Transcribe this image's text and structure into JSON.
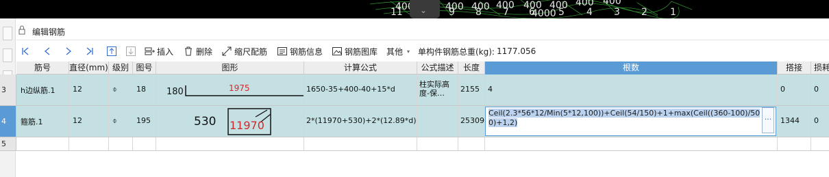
{
  "cad": {
    "dims": [
      "400",
      "400",
      "400",
      "400",
      "400",
      "400",
      "400",
      "400",
      "400"
    ],
    "dim_center": "4000",
    "nums": [
      "11",
      "9",
      "8",
      "7",
      "6",
      "5",
      "4",
      "3",
      "2",
      "1"
    ],
    "handle_glyph": "⌄"
  },
  "panel": {
    "title": "编辑钢筋"
  },
  "toolbar": {
    "insert": "插入",
    "delete": "删除",
    "scale": "缩尺配筋",
    "info": "钢筋信息",
    "library": "钢筋图库",
    "other": "其他",
    "total_label": "单构件钢筋总重(kg):",
    "total_value": "1177.056"
  },
  "columns": [
    "筋号",
    "直径(mm)",
    "级别",
    "图号",
    "图形",
    "计算公式",
    "公式描述",
    "长度",
    "根数",
    "搭接",
    "损耗"
  ],
  "rows": [
    {
      "num": "3",
      "name": "h边纵筋.1",
      "dia": "12",
      "grade": "⌽",
      "fig": "18",
      "shape_a": "180",
      "shape_b": "1975",
      "formula": "1650-35+400-40+15*d",
      "desc": "柱实际高度-保…",
      "len": "2155",
      "count": "4",
      "lap": "0",
      "loss": "0"
    },
    {
      "num": "4",
      "name": "箍筋.1",
      "dia": "12",
      "grade": "⌽",
      "fig": "195",
      "shape_a": "530",
      "shape_b": "11970",
      "formula": "2*(11970+530)+2*(12.89*d)",
      "desc": "",
      "len": "25309",
      "count": "Ceil(2.3*56*12/Min(5*12,100))+Ceil(54/150)+1+max(Ceil((360-100)/500)+1,2)",
      "ellipsis": "···",
      "lap": "1344",
      "loss": "0"
    },
    {
      "num": "5"
    }
  ]
}
